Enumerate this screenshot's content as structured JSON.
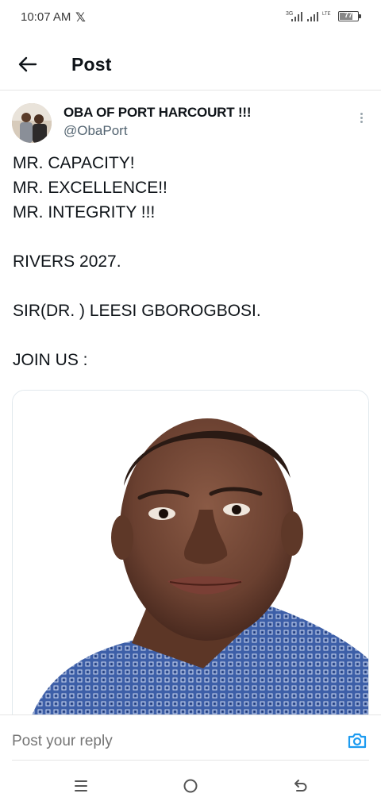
{
  "status_bar": {
    "time": "10:07 AM",
    "x_icon": "x-logo-icon",
    "network_1": "3G",
    "network_2": "LTE",
    "battery_level": "77",
    "battery_fraction": 0.77
  },
  "header": {
    "back_icon": "arrow-left-icon",
    "title": "Post"
  },
  "post": {
    "author_name": "OBA OF PORT HARCOURT !!!",
    "author_handle": "@ObaPort",
    "more_icon": "more-vertical-icon",
    "lines": [
      "MR. CAPACITY!",
      "MR. EXCELLENCE!!",
      "MR. INTEGRITY !!!",
      "RIVERS 2027.",
      "SIR(DR. ) LEESI GBOROGBOSI.",
      "JOIN US :"
    ],
    "media_icon": "portrait-photo"
  },
  "reply": {
    "placeholder": "Post your reply",
    "camera_icon": "camera-icon"
  },
  "nav": {
    "menu_icon": "menu-icon",
    "home_icon": "home-circle-icon",
    "back_icon": "back-arrow-icon"
  },
  "colors": {
    "text": "#0f1419",
    "muted": "#536471",
    "accent": "#1d9bf0",
    "shirt": "#3d5fa8"
  }
}
